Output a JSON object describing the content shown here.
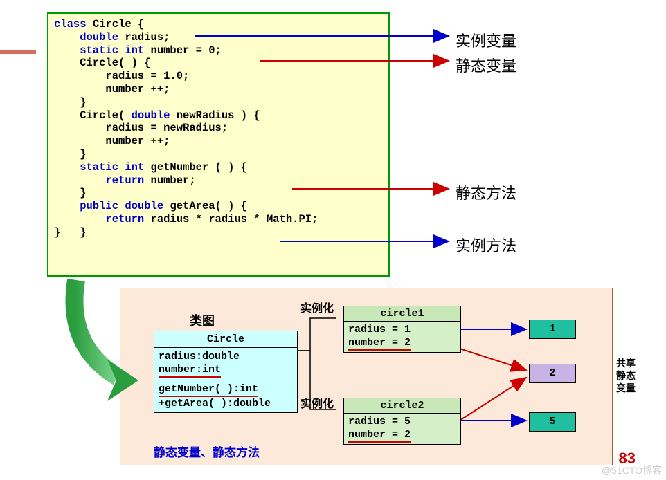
{
  "code": {
    "l1a": "class ",
    "l1b": "Circle {",
    "l2a": "    double ",
    "l2b": "radius;",
    "l3a": "    static int ",
    "l3b": "number = 0;",
    "l4": "    Circle( ) {",
    "l5": "        radius = 1.0;",
    "l6": "        number ++;",
    "l7": "    }",
    "l8a": "    Circle( ",
    "l8b": "double ",
    "l8c": "newRadius ) {",
    "l9": "        radius = newRadius;",
    "l10": "        number ++;",
    "l11": "    }",
    "l12a": "    static int ",
    "l12b": "getNumber ( ) {",
    "l13a": "        return ",
    "l13b": "number;",
    "l14": "    }",
    "l15a": "    public double ",
    "l15b": "getArea( ) {",
    "l16a": "        return ",
    "l16b": "radius * radius * Math.PI;",
    "l17": "}   }"
  },
  "labels": {
    "inst_var": "实例变量",
    "static_var": "静态变量",
    "static_method": "静态方法",
    "inst_method": "实例方法",
    "class_diagram": "类图",
    "instantiate": "实例化",
    "shared_static": "共享\n静态\n变量",
    "footer": "静态变量、静态方法"
  },
  "uml": {
    "name": "Circle",
    "attr1": "radius:double",
    "attr2": "number:int",
    "op1": "getNumber( ):int",
    "op2": "+getArea( ):double"
  },
  "inst1": {
    "name": "circle1",
    "f1": "radius = 1",
    "f2": "number = 2"
  },
  "inst2": {
    "name": "circle2",
    "f1": "radius = 5",
    "f2": "number = 2"
  },
  "vals": {
    "v1": "1",
    "v2": "2",
    "v5": "5"
  },
  "page": "83",
  "watermark": "@51CTO博客"
}
